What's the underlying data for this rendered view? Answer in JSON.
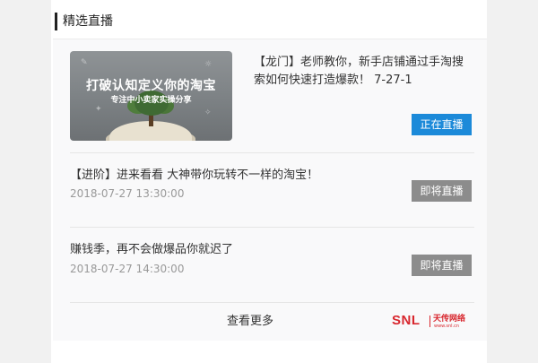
{
  "section": {
    "title": "精选直播"
  },
  "featured": {
    "thumb_title": "打破认知定义你的淘宝",
    "thumb_subtitle": "专注中小卖家实操分享",
    "title": "【龙门】老师教你，新手店铺通过手淘搜索如何快速打造爆款！ 7-27-1",
    "button": "正在直播"
  },
  "items": [
    {
      "title": "【进阶】进来看看 大神带你玩转不一样的淘宝！",
      "date": "2018-07-27 13:30:00",
      "button": "即将直播"
    },
    {
      "title": "赚钱季，再不会做爆品你就迟了",
      "date": "2018-07-27 14:30:00",
      "button": "即将直播"
    }
  ],
  "footer": {
    "more": "查看更多",
    "logo_mark": "SNL",
    "logo_cn": "天传网络",
    "logo_en": "www.snl.cn"
  },
  "colors": {
    "live": "#1c8ad9",
    "soon": "#8c8c8c",
    "brand": "#d8262d"
  },
  "icons": [
    "tree-book-thumbnail"
  ]
}
